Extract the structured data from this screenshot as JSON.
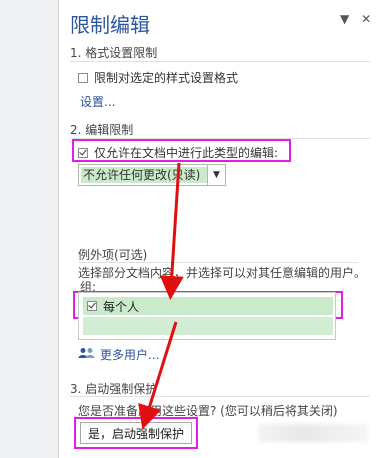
{
  "pane": {
    "title": "限制编辑",
    "dropdown_icon": "chevron-down-icon",
    "close_icon": "close-icon"
  },
  "section1": {
    "title": "1. 格式设置限制",
    "checkbox_label": "限制对选定的样式设置格式",
    "checkbox_checked": false,
    "settings_link": "设置..."
  },
  "section2": {
    "title": "2. 编辑限制",
    "checkbox_label": "仅允许在文档中进行此类型的编辑:",
    "checkbox_checked": true,
    "edit_type_selected": "不允许任何更改(只读)",
    "exceptions_title": "例外项(可选)",
    "exceptions_desc": "选择部分文档内容，并选择可以对其任意编辑的用户。",
    "groups_label": "组:",
    "groups": [
      {
        "label": "每个人",
        "checked": true
      }
    ],
    "more_users_link": "更多用户..."
  },
  "section3": {
    "title": "3. 启动强制保护",
    "question": "您是否准备应用这些设置? (您可以稍后将其关闭)",
    "enforce_button": "是，启动强制保护"
  },
  "annotation_color": "#e020e0",
  "accent_color": "#2b579a",
  "selection_color": "#c9eacb"
}
